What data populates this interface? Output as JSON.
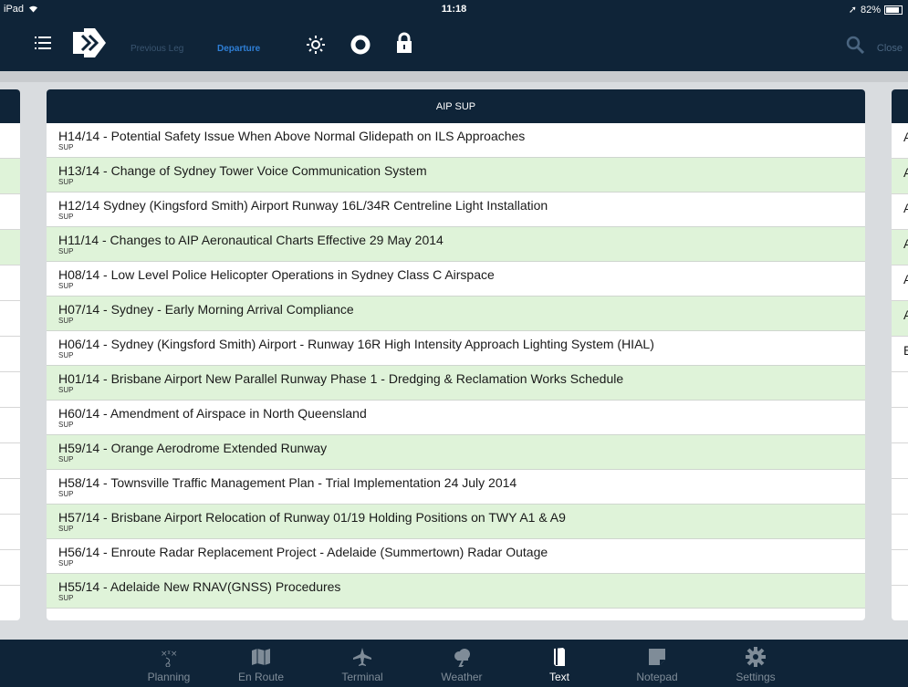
{
  "status": {
    "device": "iPad",
    "time": "11:18",
    "battery": "82%"
  },
  "nav": {
    "prev_label": "Previous Leg",
    "departure_label": "Departure",
    "close_label": "Close"
  },
  "panel": {
    "title": "AIP SUP"
  },
  "items": [
    {
      "title": "H14/14 - Potential Safety Issue When Above Normal Glidepath on ILS Approaches",
      "sub": "SUP"
    },
    {
      "title": "H13/14 - Change of Sydney Tower Voice Communication System",
      "sub": "SUP"
    },
    {
      "title": "H12/14 Sydney (Kingsford Smith) Airport Runway 16L/34R Centreline Light Installation",
      "sub": "SUP"
    },
    {
      "title": "H11/14 - Changes to AIP Aeronautical Charts Effective 29 May 2014",
      "sub": "SUP"
    },
    {
      "title": "H08/14 - Low Level Police Helicopter Operations in Sydney Class C Airspace",
      "sub": "SUP"
    },
    {
      "title": "H07/14 - Sydney - Early Morning Arrival Compliance",
      "sub": "SUP"
    },
    {
      "title": "H06/14 - Sydney (Kingsford Smith) Airport - Runway 16R High Intensity Approach Lighting System (HIAL)",
      "sub": "SUP"
    },
    {
      "title": "H01/14 - Brisbane Airport New Parallel Runway Phase 1 - Dredging & Reclamation Works Schedule",
      "sub": "SUP"
    },
    {
      "title": "H60/14 - Amendment of Airspace in North Queensland",
      "sub": "SUP"
    },
    {
      "title": "H59/14 - Orange Aerodrome Extended Runway",
      "sub": "SUP"
    },
    {
      "title": "H58/14 - Townsville Traffic Management Plan - Trial Implementation 24 July 2014",
      "sub": "SUP"
    },
    {
      "title": "H57/14 - Brisbane Airport Relocation of Runway 01/19 Holding Positions on TWY A1 & A9",
      "sub": "SUP"
    },
    {
      "title": "H56/14 - Enroute Radar Replacement Project - Adelaide (Summertown) Radar Outage",
      "sub": "SUP"
    },
    {
      "title": "H55/14 - Adelaide New RNAV(GNSS) Procedures",
      "sub": "SUP"
    }
  ],
  "right_letters": [
    "A",
    "A",
    "A",
    "A",
    "A",
    "A",
    "E"
  ],
  "tabs": [
    {
      "label": "Planning",
      "icon": "planning-icon"
    },
    {
      "label": "En Route",
      "icon": "map-icon"
    },
    {
      "label": "Terminal",
      "icon": "plane-icon"
    },
    {
      "label": "Weather",
      "icon": "weather-icon"
    },
    {
      "label": "Text",
      "icon": "document-icon"
    },
    {
      "label": "Notepad",
      "icon": "notepad-icon"
    },
    {
      "label": "Settings",
      "icon": "gear-icon"
    }
  ],
  "colors": {
    "bar": "#0f2438",
    "row_alt": "#dff3d9",
    "accent": "#2f7fd6"
  }
}
